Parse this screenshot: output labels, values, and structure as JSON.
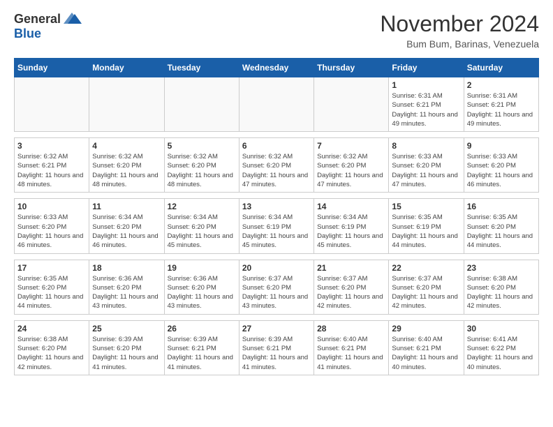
{
  "logo": {
    "general": "General",
    "blue": "Blue"
  },
  "title": "November 2024",
  "location": "Bum Bum, Barinas, Venezuela",
  "days_of_week": [
    "Sunday",
    "Monday",
    "Tuesday",
    "Wednesday",
    "Thursday",
    "Friday",
    "Saturday"
  ],
  "weeks": [
    [
      {
        "day": "",
        "info": ""
      },
      {
        "day": "",
        "info": ""
      },
      {
        "day": "",
        "info": ""
      },
      {
        "day": "",
        "info": ""
      },
      {
        "day": "",
        "info": ""
      },
      {
        "day": "1",
        "info": "Sunrise: 6:31 AM\nSunset: 6:21 PM\nDaylight: 11 hours and 49 minutes."
      },
      {
        "day": "2",
        "info": "Sunrise: 6:31 AM\nSunset: 6:21 PM\nDaylight: 11 hours and 49 minutes."
      }
    ],
    [
      {
        "day": "3",
        "info": "Sunrise: 6:32 AM\nSunset: 6:21 PM\nDaylight: 11 hours and 48 minutes."
      },
      {
        "day": "4",
        "info": "Sunrise: 6:32 AM\nSunset: 6:20 PM\nDaylight: 11 hours and 48 minutes."
      },
      {
        "day": "5",
        "info": "Sunrise: 6:32 AM\nSunset: 6:20 PM\nDaylight: 11 hours and 48 minutes."
      },
      {
        "day": "6",
        "info": "Sunrise: 6:32 AM\nSunset: 6:20 PM\nDaylight: 11 hours and 47 minutes."
      },
      {
        "day": "7",
        "info": "Sunrise: 6:32 AM\nSunset: 6:20 PM\nDaylight: 11 hours and 47 minutes."
      },
      {
        "day": "8",
        "info": "Sunrise: 6:33 AM\nSunset: 6:20 PM\nDaylight: 11 hours and 47 minutes."
      },
      {
        "day": "9",
        "info": "Sunrise: 6:33 AM\nSunset: 6:20 PM\nDaylight: 11 hours and 46 minutes."
      }
    ],
    [
      {
        "day": "10",
        "info": "Sunrise: 6:33 AM\nSunset: 6:20 PM\nDaylight: 11 hours and 46 minutes."
      },
      {
        "day": "11",
        "info": "Sunrise: 6:34 AM\nSunset: 6:20 PM\nDaylight: 11 hours and 46 minutes."
      },
      {
        "day": "12",
        "info": "Sunrise: 6:34 AM\nSunset: 6:20 PM\nDaylight: 11 hours and 45 minutes."
      },
      {
        "day": "13",
        "info": "Sunrise: 6:34 AM\nSunset: 6:19 PM\nDaylight: 11 hours and 45 minutes."
      },
      {
        "day": "14",
        "info": "Sunrise: 6:34 AM\nSunset: 6:19 PM\nDaylight: 11 hours and 45 minutes."
      },
      {
        "day": "15",
        "info": "Sunrise: 6:35 AM\nSunset: 6:19 PM\nDaylight: 11 hours and 44 minutes."
      },
      {
        "day": "16",
        "info": "Sunrise: 6:35 AM\nSunset: 6:20 PM\nDaylight: 11 hours and 44 minutes."
      }
    ],
    [
      {
        "day": "17",
        "info": "Sunrise: 6:35 AM\nSunset: 6:20 PM\nDaylight: 11 hours and 44 minutes."
      },
      {
        "day": "18",
        "info": "Sunrise: 6:36 AM\nSunset: 6:20 PM\nDaylight: 11 hours and 43 minutes."
      },
      {
        "day": "19",
        "info": "Sunrise: 6:36 AM\nSunset: 6:20 PM\nDaylight: 11 hours and 43 minutes."
      },
      {
        "day": "20",
        "info": "Sunrise: 6:37 AM\nSunset: 6:20 PM\nDaylight: 11 hours and 43 minutes."
      },
      {
        "day": "21",
        "info": "Sunrise: 6:37 AM\nSunset: 6:20 PM\nDaylight: 11 hours and 42 minutes."
      },
      {
        "day": "22",
        "info": "Sunrise: 6:37 AM\nSunset: 6:20 PM\nDaylight: 11 hours and 42 minutes."
      },
      {
        "day": "23",
        "info": "Sunrise: 6:38 AM\nSunset: 6:20 PM\nDaylight: 11 hours and 42 minutes."
      }
    ],
    [
      {
        "day": "24",
        "info": "Sunrise: 6:38 AM\nSunset: 6:20 PM\nDaylight: 11 hours and 42 minutes."
      },
      {
        "day": "25",
        "info": "Sunrise: 6:39 AM\nSunset: 6:20 PM\nDaylight: 11 hours and 41 minutes."
      },
      {
        "day": "26",
        "info": "Sunrise: 6:39 AM\nSunset: 6:21 PM\nDaylight: 11 hours and 41 minutes."
      },
      {
        "day": "27",
        "info": "Sunrise: 6:39 AM\nSunset: 6:21 PM\nDaylight: 11 hours and 41 minutes."
      },
      {
        "day": "28",
        "info": "Sunrise: 6:40 AM\nSunset: 6:21 PM\nDaylight: 11 hours and 41 minutes."
      },
      {
        "day": "29",
        "info": "Sunrise: 6:40 AM\nSunset: 6:21 PM\nDaylight: 11 hours and 40 minutes."
      },
      {
        "day": "30",
        "info": "Sunrise: 6:41 AM\nSunset: 6:22 PM\nDaylight: 11 hours and 40 minutes."
      }
    ]
  ]
}
